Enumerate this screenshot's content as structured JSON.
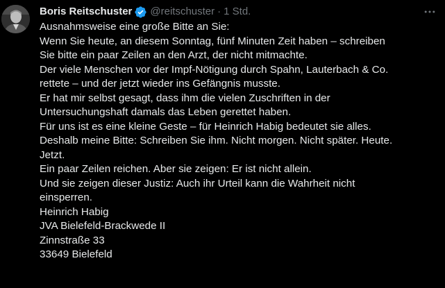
{
  "tweet": {
    "author": {
      "display_name": "Boris Reitschuster",
      "handle": "@reitschuster",
      "verified": true,
      "verified_icon": "verified-badge-icon",
      "verified_color": "#1d9bf0"
    },
    "separator": "·",
    "timestamp": "1 Std.",
    "more_icon": "more-options-icon",
    "lines": [
      "Ausnahmsweise eine große Bitte an Sie:",
      "Wenn Sie heute, an diesem Sonntag, fünf Minuten Zeit haben – schreiben",
      "Sie bitte ein paar Zeilen an den Arzt, der nicht mitmachte.",
      "Der viele Menschen vor der Impf-Nötigung durch Spahn, Lauterbach & Co.",
      "rettete – und der jetzt wieder ins Gefängnis musste.",
      "Er hat mir selbst gesagt, dass ihm die vielen Zuschriften in der",
      "Untersuchungshaft damals das Leben gerettet haben.",
      "Für uns ist es eine kleine Geste – für Heinrich Habig bedeutet sie alles.",
      "Deshalb meine Bitte: Schreiben Sie ihm. Nicht morgen. Nicht später. Heute.",
      "Jetzt.",
      "Ein paar Zeilen reichen. Aber sie zeigen: Er ist nicht allein.",
      "Und sie zeigen dieser Justiz: Auch ihr Urteil kann die Wahrheit nicht",
      "einsperren.",
      "Heinrich Habig",
      "JVA Bielefeld-Brackwede II",
      "Zinnstraße 33",
      "33649 Bielefeld"
    ]
  },
  "colors": {
    "background": "#000000",
    "text": "#e7e9ea",
    "secondary_text": "#71767b",
    "accent": "#1d9bf0"
  }
}
